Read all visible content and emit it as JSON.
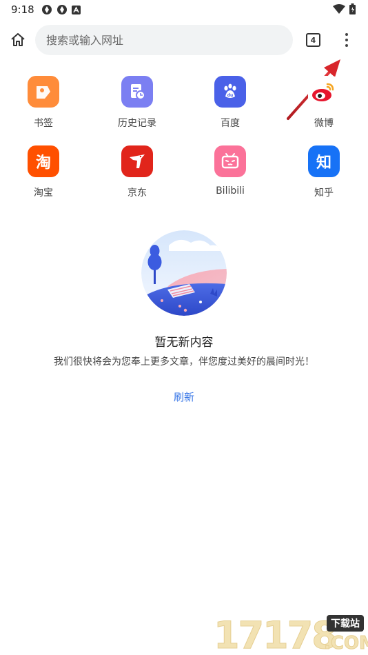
{
  "status_bar": {
    "time": "9:18",
    "left_icons": [
      "settings-sync-icon",
      "settings-sync-icon",
      "text-a-icon"
    ],
    "right_icons": [
      "wifi-icon",
      "battery-charging-icon"
    ]
  },
  "toolbar": {
    "search_placeholder": "搜索或输入网址",
    "tab_count": "4"
  },
  "shortcuts": [
    {
      "label": "书签",
      "icon": "bookmark-icon",
      "color": "#ff8c3a",
      "glyph": ""
    },
    {
      "label": "历史记录",
      "icon": "history-icon",
      "color": "#7b7ff2",
      "glyph": ""
    },
    {
      "label": "百度",
      "icon": "baidu-paw-icon",
      "color": "#4a61e8",
      "glyph": ""
    },
    {
      "label": "微博",
      "icon": "weibo-icon",
      "color": "#ffffff",
      "glyph": ""
    },
    {
      "label": "淘宝",
      "icon": "taobao-icon",
      "color": "#ff5000",
      "glyph": "淘"
    },
    {
      "label": "京东",
      "icon": "jd-dog-icon",
      "color": "#e1251b",
      "glyph": ""
    },
    {
      "label": "Bilibili",
      "icon": "bilibili-tv-icon",
      "color": "#fb7299",
      "glyph": ""
    },
    {
      "label": "知乎",
      "icon": "zhihu-icon",
      "color": "#1772f6",
      "glyph": "知"
    }
  ],
  "empty_state": {
    "title": "暂无新内容",
    "description": "我们很快将会为您奉上更多文章，伴您度过美好的晨间时光！",
    "refresh_label": "刷新"
  },
  "watermark": {
    "digits": "17178",
    "tag": "下载站",
    "suffix": ".COM"
  },
  "colors": {
    "accent": "#3b78e7",
    "arrow": "#d8262b"
  }
}
